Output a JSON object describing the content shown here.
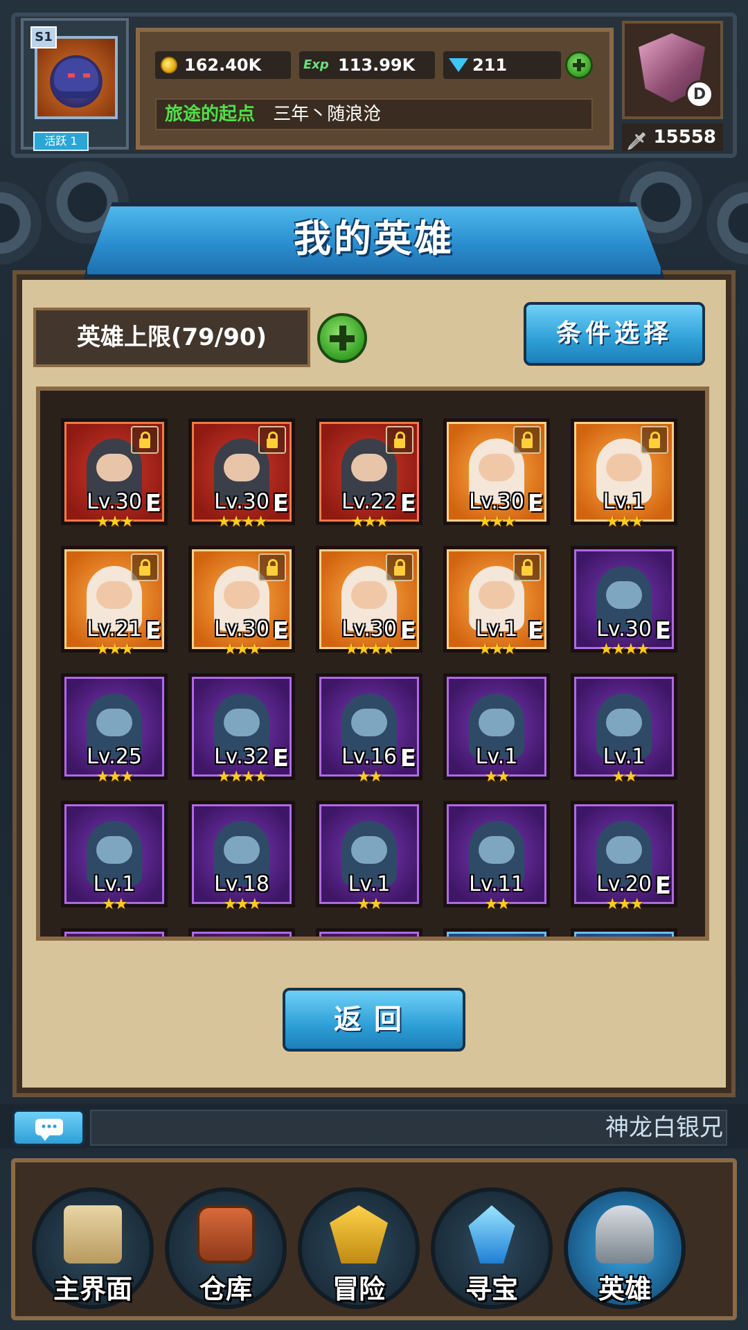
{
  "player": {
    "season_badge": "S1",
    "active_label": "活跃 1"
  },
  "resources": {
    "gold": "162.40K",
    "exp_label": "Exp",
    "exp": "113.99K",
    "gems": "211"
  },
  "title": {
    "rank_name": "旅途的起点",
    "player_name": "三年丶随浪沧"
  },
  "guild": {
    "rank_letter": "D",
    "power": "15558"
  },
  "page": {
    "title": "我的英雄",
    "capacity": "英雄上限(79/90)",
    "filter_button": "条件选择",
    "back_button": "返回"
  },
  "heroes": [
    {
      "level": "Lv.30",
      "equip": "E",
      "stars": "★★★",
      "rarity": "red",
      "locked": true
    },
    {
      "level": "Lv.30",
      "equip": "E",
      "stars": "★★★★",
      "rarity": "red",
      "locked": true
    },
    {
      "level": "Lv.22",
      "equip": "E",
      "stars": "★★★",
      "rarity": "red",
      "locked": true
    },
    {
      "level": "Lv.30",
      "equip": "E",
      "stars": "★★★",
      "rarity": "orange",
      "locked": true
    },
    {
      "level": "Lv.1",
      "equip": "",
      "stars": "★★★",
      "rarity": "orange",
      "locked": true
    },
    {
      "level": "Lv.21",
      "equip": "E",
      "stars": "★★★",
      "rarity": "orange",
      "locked": true
    },
    {
      "level": "Lv.30",
      "equip": "E",
      "stars": "★★★",
      "rarity": "orange",
      "locked": true
    },
    {
      "level": "Lv.30",
      "equip": "E",
      "stars": "★★★★",
      "rarity": "orange",
      "locked": true
    },
    {
      "level": "Lv.1",
      "equip": "E",
      "stars": "★★★",
      "rarity": "orange",
      "locked": true
    },
    {
      "level": "Lv.30",
      "equip": "E",
      "stars": "★★★★",
      "rarity": "purple",
      "locked": false
    },
    {
      "level": "Lv.25",
      "equip": "",
      "stars": "★★★",
      "rarity": "purple",
      "locked": false
    },
    {
      "level": "Lv.32",
      "equip": "E",
      "stars": "★★★★",
      "rarity": "purple",
      "locked": false
    },
    {
      "level": "Lv.16",
      "equip": "E",
      "stars": "★★",
      "rarity": "purple",
      "locked": false
    },
    {
      "level": "Lv.1",
      "equip": "",
      "stars": "★★",
      "rarity": "purple",
      "locked": false
    },
    {
      "level": "Lv.1",
      "equip": "",
      "stars": "★★",
      "rarity": "purple",
      "locked": false
    },
    {
      "level": "Lv.1",
      "equip": "",
      "stars": "★★",
      "rarity": "purple",
      "locked": false
    },
    {
      "level": "Lv.18",
      "equip": "",
      "stars": "★★★",
      "rarity": "purple",
      "locked": false
    },
    {
      "level": "Lv.1",
      "equip": "",
      "stars": "★★",
      "rarity": "purple",
      "locked": false
    },
    {
      "level": "Lv.11",
      "equip": "",
      "stars": "★★",
      "rarity": "purple",
      "locked": false
    },
    {
      "level": "Lv.20",
      "equip": "E",
      "stars": "★★★",
      "rarity": "purple",
      "locked": false
    }
  ],
  "chat": {
    "ticker": "神龙白银兄"
  },
  "nav": [
    {
      "label": "主界面",
      "icon": "scroll-icon",
      "active": false
    },
    {
      "label": "仓库",
      "icon": "backpack-icon",
      "active": false
    },
    {
      "label": "冒险",
      "icon": "crest-icon",
      "active": false
    },
    {
      "label": "寻宝",
      "icon": "crystal-icon",
      "active": false
    },
    {
      "label": "英雄",
      "icon": "helmet-icon",
      "active": true
    }
  ],
  "colors": {
    "panel": "#d8c49a",
    "accent_blue": "#2e9fd6",
    "green_text": "#4fe04a",
    "star": "#ffcc22"
  }
}
